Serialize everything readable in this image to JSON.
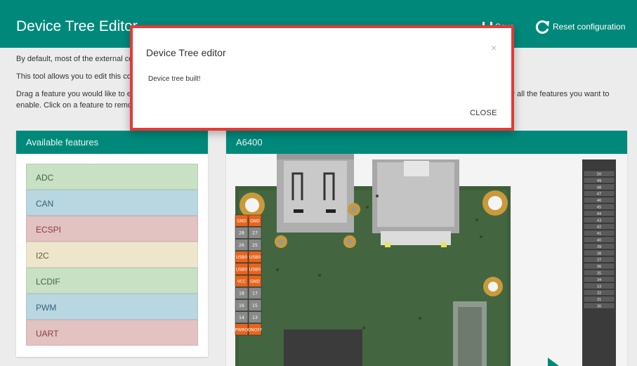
{
  "navbar": {
    "title": "Device Tree Editor",
    "save_label": "Save",
    "reset_label": "Reset configuration"
  },
  "intro": {
    "line1": "By default, most of the external connector pins are configured as GPIO.",
    "line2": "This tool allows you to edit this configuration.",
    "line3": "Drag a feature you would like to enable from the available features panel and drop it on the pins, but only in the white-highlighted ones. Repeat for all the features you want to enable. Click on a feature to remove it from a pin."
  },
  "features_panel": {
    "title": "Available features",
    "items": [
      {
        "label": "ADC",
        "bg": "#c8e0c4",
        "fg": "#3a6b3a"
      },
      {
        "label": "CAN",
        "bg": "#b9d7e1",
        "fg": "#35627a"
      },
      {
        "label": "ECSPI",
        "bg": "#e3c2c2",
        "fg": "#8a3c3c"
      },
      {
        "label": "I2C",
        "bg": "#ede6cd",
        "fg": "#6b5b2e"
      },
      {
        "label": "LCDIF",
        "bg": "#c8e0c4",
        "fg": "#3a6b3a"
      },
      {
        "label": "PWM",
        "bg": "#b9d7e1",
        "fg": "#35627a"
      },
      {
        "label": "UART",
        "bg": "#e3c2c2",
        "fg": "#8a3c3c"
      }
    ]
  },
  "board_panel": {
    "title": "A6400",
    "left_header_pins": [
      {
        "a": "GND",
        "b": "GND",
        "color": "#e8641e"
      },
      {
        "a": "28",
        "b": "27",
        "color": "#8a8a8a"
      },
      {
        "a": "26",
        "b": "25",
        "color": "#8a8a8a"
      },
      {
        "a": "USB0",
        "b": "USB0",
        "color": "#e8641e"
      },
      {
        "a": "USB0",
        "b": "USB0",
        "color": "#e8641e"
      },
      {
        "a": "VCC",
        "b": "GND",
        "color": "#e8641e"
      },
      {
        "a": "18",
        "b": "17",
        "color": "#8a8a8a"
      },
      {
        "a": "16",
        "b": "15",
        "color": "#8a8a8a"
      },
      {
        "a": "14",
        "b": "13",
        "color": "#8a8a8a"
      },
      {
        "a": "PWRO",
        "b": "ONOFF",
        "color": "#e8641e"
      }
    ],
    "right_header_pins": [
      "50",
      "49",
      "48",
      "47",
      "46",
      "45",
      "44",
      "43",
      "42",
      "41",
      "40",
      "39",
      "38",
      "37",
      "36",
      "35",
      "34",
      "33",
      "32",
      "31",
      "30"
    ]
  },
  "modal": {
    "title": "Device Tree editor",
    "close_x": "×",
    "message": "Device tree built!",
    "close_button": "CLOSE"
  }
}
